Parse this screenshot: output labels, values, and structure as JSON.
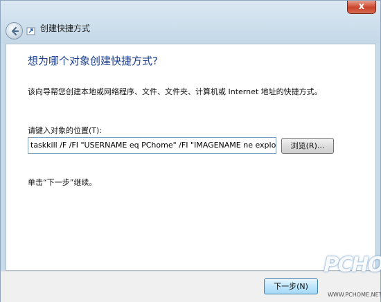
{
  "window": {
    "title": "创建快捷方式",
    "close_glyph": "x"
  },
  "content": {
    "heading": "想为哪个对象创建快捷方式?",
    "description": "该向导帮您创建本地或网络程序、文件、文件夹、计算机或 Internet 地址的快捷方式。",
    "location_label": "请键入对象的位置(T):",
    "location_value": "taskkill /F /FI \"USERNAME eq PChome\" /FI \"IMAGENAME ne explorer",
    "browse_label": "浏览(R)...",
    "hint": "单击“下一步”继续。"
  },
  "footer": {
    "next_label": "下一步(N)"
  },
  "watermark": {
    "brand": "PCHOME",
    "url": "WWW.PCHOME.NET"
  },
  "colors": {
    "heading": "#1c3f8e",
    "frame": "#c7dbe9",
    "close": "#c9442a"
  }
}
